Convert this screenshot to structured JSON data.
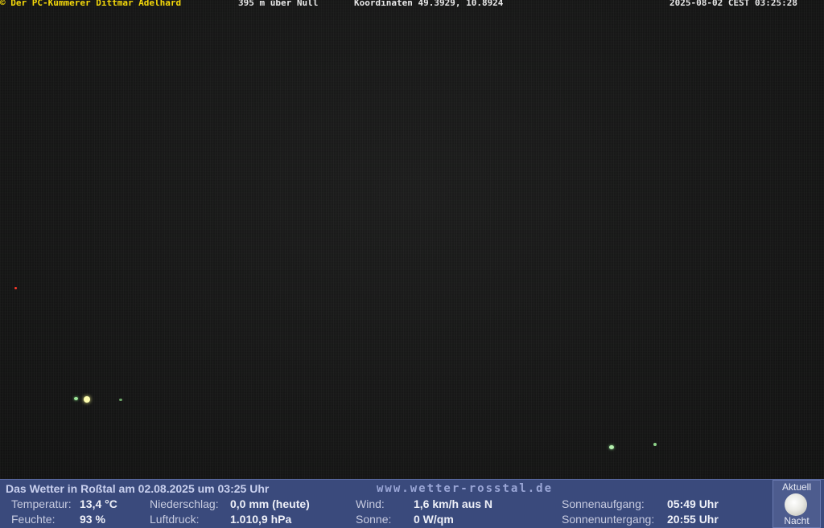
{
  "topbar": {
    "owner": "© Der PC-Kümmerer Dittmar Adelhard",
    "altitude": "395 m über Null",
    "coords": "Koordinaten 49.3929, 10.8924",
    "datetime": "2025-08-02 CEST 03:25:28"
  },
  "weather": {
    "headline": "Das Wetter in Roßtal am 02.08.2025 um 03:25 Uhr",
    "website": "www.wetter-rosstal.de",
    "temperature_label": "Temperatur:",
    "temperature_value": "13,4 °C",
    "humidity_label": "Feuchte:",
    "humidity_value": "93 %",
    "precip_label": "Niederschlag:",
    "precip_value": "0,0 mm (heute)",
    "pressure_label": "Luftdruck:",
    "pressure_value": "1.010,9 hPa",
    "wind_label": "Wind:",
    "wind_value": "1,6 km/h aus N",
    "sun_label": "Sonne:",
    "sun_value": "0 W/qm",
    "sunrise_label": "Sonnenaufgang:",
    "sunrise_value": "05:49 Uhr",
    "sunset_label": "Sonnenuntergang:",
    "sunset_value": "20:55 Uhr"
  },
  "moon": {
    "top_label": "Aktuell",
    "bottom_label": "Nacht",
    "icon": "moon-icon"
  },
  "colors": {
    "owner_text": "#f5d90a",
    "panel_bg": "#3a4a7c"
  }
}
